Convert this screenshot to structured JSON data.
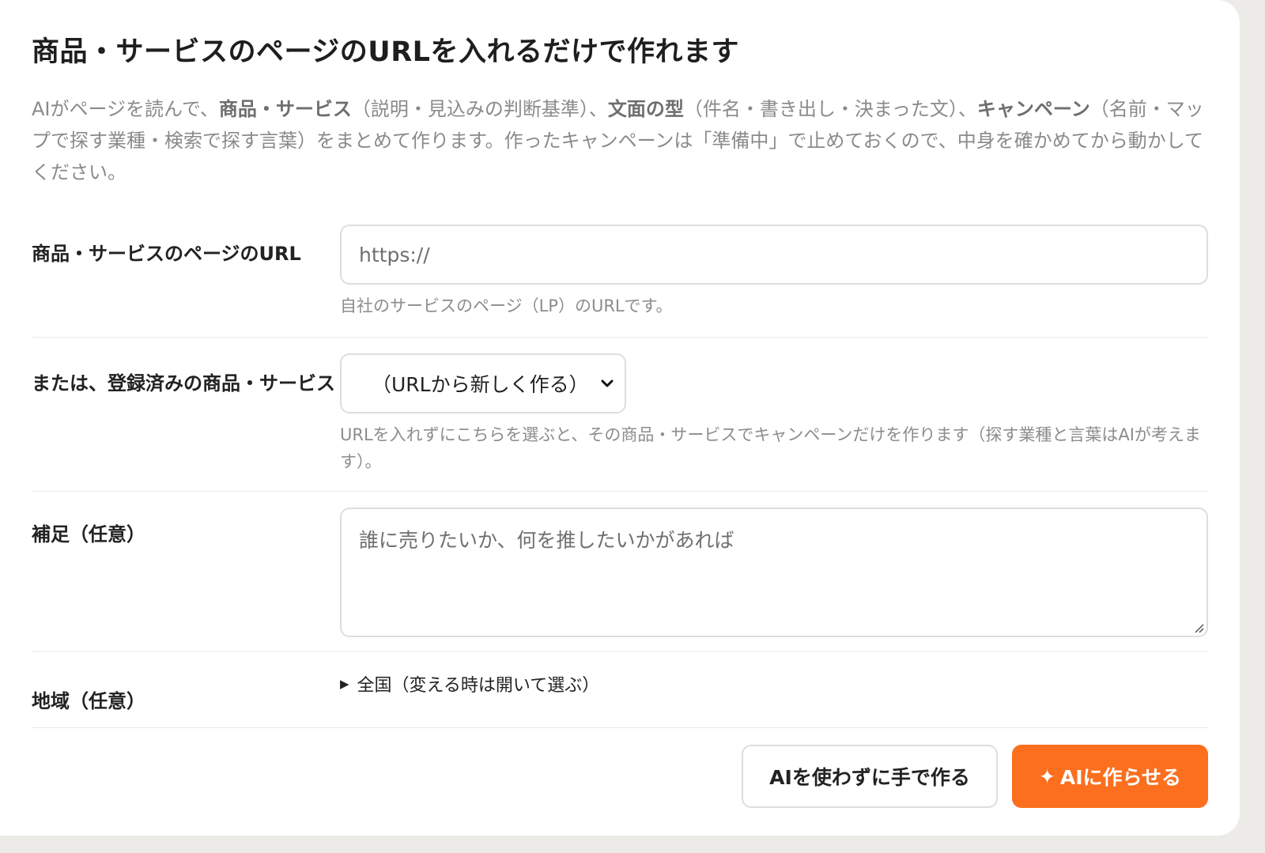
{
  "header": {
    "title": "商品・サービスのページのURLを入れるだけで作れます"
  },
  "description": {
    "part1": "AIがページを読んで、",
    "bold1": "商品・サービス",
    "part2": "（説明・見込みの判断基準）、",
    "bold2": "文面の型",
    "part3": "（件名・書き出し・決まった文）、",
    "bold3": "キャンペーン",
    "part4": "（名前・マップで探す業種・検索で探す言葉）をまとめて作ります。作ったキャンペーンは「準備中」で止めておくので、中身を確かめてから動かしてください。"
  },
  "form": {
    "url": {
      "label": "商品・サービスのページのURL",
      "placeholder": "https://",
      "value": "",
      "hint": "自社のサービスのページ（LP）のURLです。"
    },
    "registered": {
      "label": "または、登録済みの商品・サービス",
      "selected": "（URLから新しく作る）",
      "hint": "URLを入れずにこちらを選ぶと、その商品・サービスでキャンペーンだけを作ります（探す業種と言葉はAIが考えます）。"
    },
    "notes": {
      "label": "補足（任意）",
      "placeholder": "誰に売りたいか、何を推したいかがあれば",
      "value": ""
    },
    "region": {
      "label": "地域（任意）",
      "summary": "全国（変える時は開いて選ぶ）"
    }
  },
  "actions": {
    "manual_label": "AIを使わずに手で作る",
    "ai_label": "AIに作らせる",
    "ai_icon": "✦"
  },
  "colors": {
    "accent": "#fb6f1e",
    "muted_text": "#8a8a8a",
    "border": "#dededa"
  }
}
